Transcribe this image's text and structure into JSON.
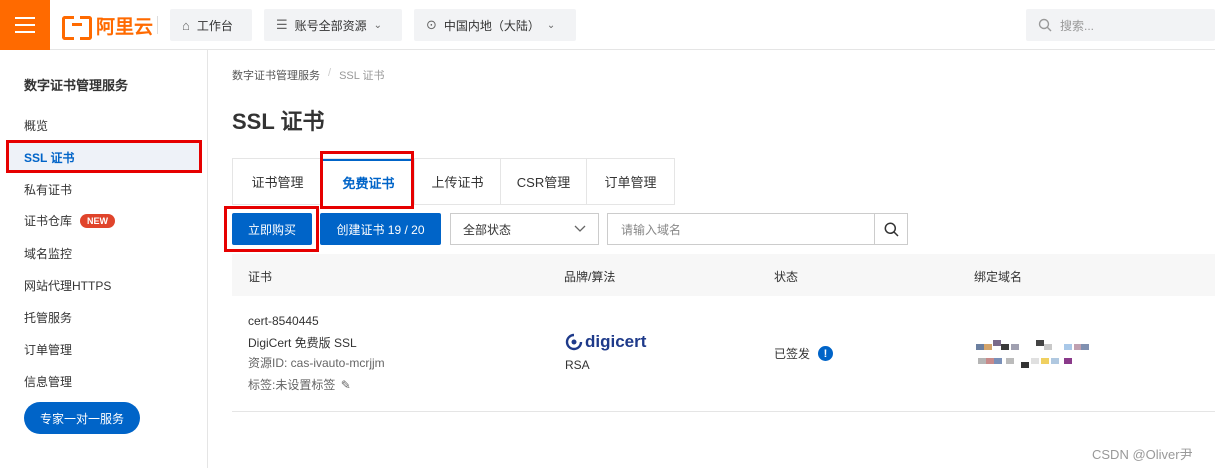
{
  "topbar": {
    "brand": "阿里云",
    "workbench_label": "工作台",
    "resource_label": "账号全部资源",
    "region_label": "中国内地（大陆）",
    "search_placeholder": "搜索..."
  },
  "sidebar": {
    "title": "数字证书管理服务",
    "items": [
      {
        "label": "概览"
      },
      {
        "label": "SSL 证书"
      },
      {
        "label": "私有证书"
      },
      {
        "label": "证书仓库",
        "badge": "NEW"
      },
      {
        "label": "域名监控"
      },
      {
        "label": "网站代理HTTPS"
      },
      {
        "label": "托管服务"
      },
      {
        "label": "订单管理"
      },
      {
        "label": "信息管理"
      }
    ],
    "expert_button": "专家一对一服务"
  },
  "breadcrumb": {
    "root": "数字证书管理服务",
    "sep": "/",
    "current": "SSL 证书"
  },
  "page_title": "SSL 证书",
  "tabs": [
    {
      "label": "证书管理"
    },
    {
      "label": "免费证书"
    },
    {
      "label": "上传证书"
    },
    {
      "label": "CSR管理"
    },
    {
      "label": "订单管理"
    }
  ],
  "toolbar": {
    "buy_label": "立即购买",
    "create_label": "创建证书 19 / 20",
    "status_select": "全部状态",
    "domain_placeholder": "请输入域名"
  },
  "table": {
    "headers": [
      "证书",
      "品牌/算法",
      "状态",
      "绑定域名"
    ],
    "rows": [
      {
        "cert_name": "cert-8540445",
        "cert_type": "DigiCert 免费版 SSL",
        "resource_id": "资源ID: cas-ivauto-mcrjjm",
        "tags": "标签:未设置标签",
        "brand": "digicert",
        "algorithm": "RSA",
        "status": "已签发"
      }
    ]
  },
  "watermark": "CSDN @Oliver尹",
  "colors": {
    "accent": "#0064c8",
    "brand": "#ff6a00",
    "annotation": "#e60000"
  }
}
